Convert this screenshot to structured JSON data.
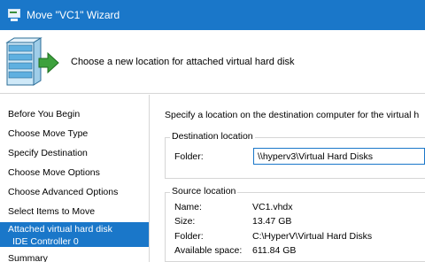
{
  "window": {
    "title": "Move \"VC1\" Wizard",
    "app_icon": "hyper-v-manager-icon"
  },
  "header": {
    "text": "Choose a new location for attached virtual hard disk",
    "icon": "server-stack-icon",
    "arrow_color": "#3da13d"
  },
  "nav": {
    "items": [
      {
        "label": "Before You Begin"
      },
      {
        "label": "Choose Move Type"
      },
      {
        "label": "Specify Destination"
      },
      {
        "label": "Choose Move Options"
      },
      {
        "label": "Choose Advanced Options"
      },
      {
        "label": "Select Items to Move"
      },
      {
        "label": "Attached virtual hard disk",
        "sublabel": "IDE Controller 0",
        "active": true
      },
      {
        "label": "Summary"
      }
    ]
  },
  "content": {
    "intro": "Specify a location on the destination computer for the virtual h",
    "destination": {
      "label": "Destination location",
      "folder_label": "Folder:",
      "folder_value": "\\\\hyperv3\\Virtual Hard Disks"
    },
    "source": {
      "label": "Source location",
      "name_label": "Name:",
      "name_value": "VC1.vhdx",
      "size_label": "Size:",
      "size_value": "13.47 GB",
      "folder_label": "Folder:",
      "folder_value": "C:\\HyperV\\Virtual Hard Disks",
      "space_label": "Available space:",
      "space_value": "611.84 GB"
    }
  },
  "colors": {
    "accent": "#1a77c9"
  }
}
